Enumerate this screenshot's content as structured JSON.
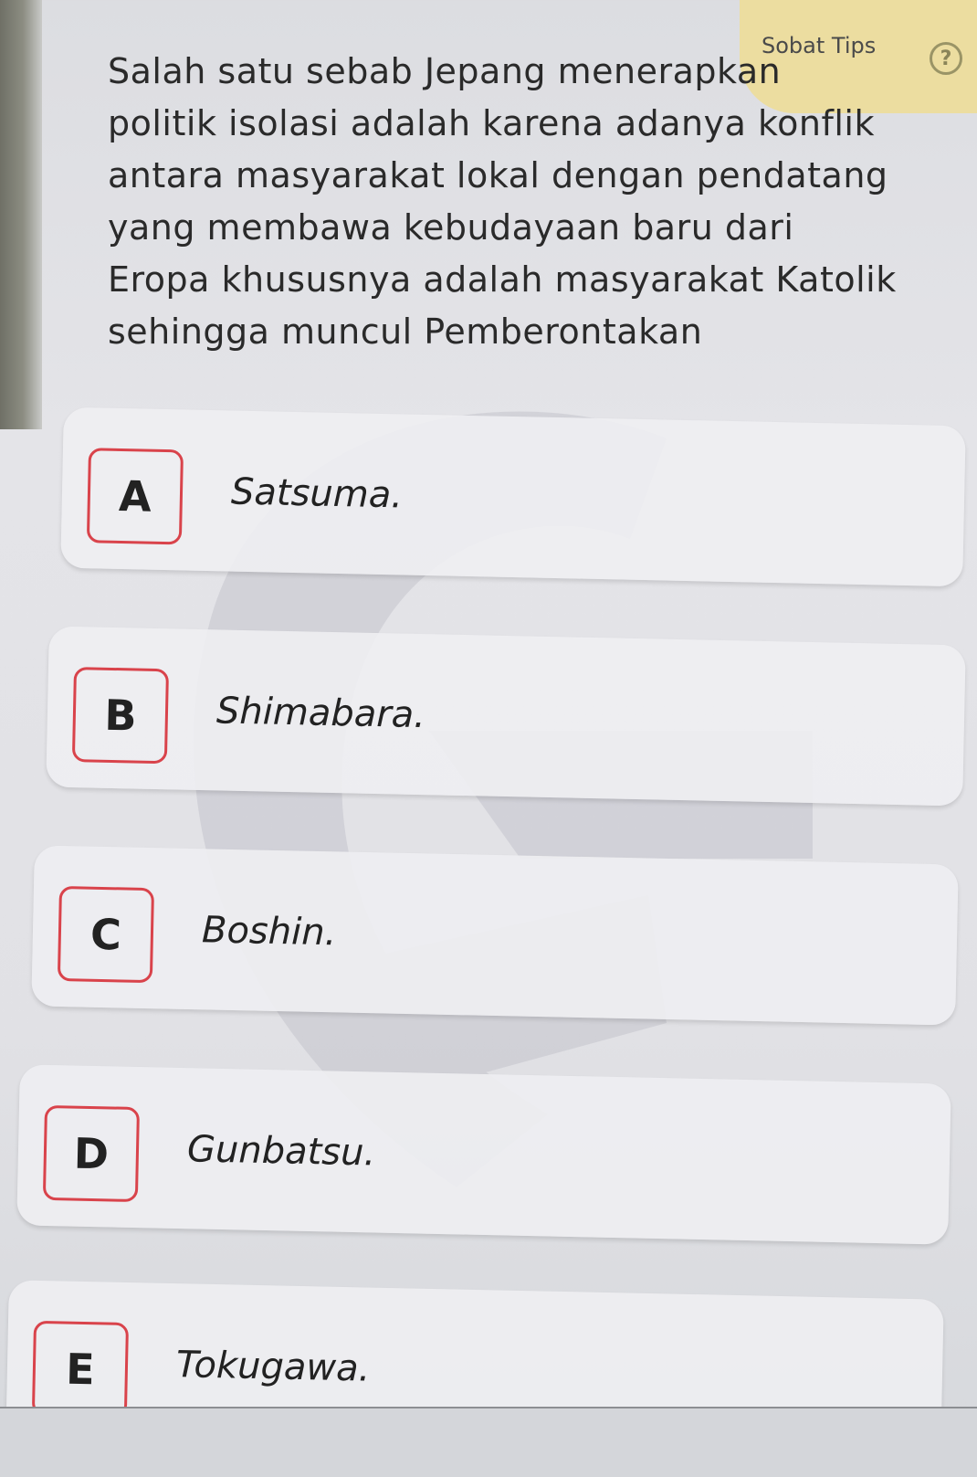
{
  "tips": {
    "label": "Sobat Tips",
    "icon": "help-circle-icon",
    "icon_glyph": "?"
  },
  "question": {
    "lines": [
      "Salah satu sebab Jepang menerapkan",
      "politik isolasi adalah karena adanya konflik",
      "antara masyarakat lokal dengan pendatang",
      "yang membawa kebudayaan baru dari",
      "Eropa khususnya adalah masyarakat Katolik",
      "sehingga muncul Pemberontakan"
    ]
  },
  "options": [
    {
      "letter": "A",
      "text": "Satsuma."
    },
    {
      "letter": "B",
      "text": "Shimabara."
    },
    {
      "letter": "C",
      "text": "Boshin."
    },
    {
      "letter": "D",
      "text": "Gunbatsu."
    },
    {
      "letter": "E",
      "text": "Tokugawa."
    }
  ],
  "colors": {
    "accent_border": "#d9434b",
    "tips_background": "#ecdda0"
  }
}
